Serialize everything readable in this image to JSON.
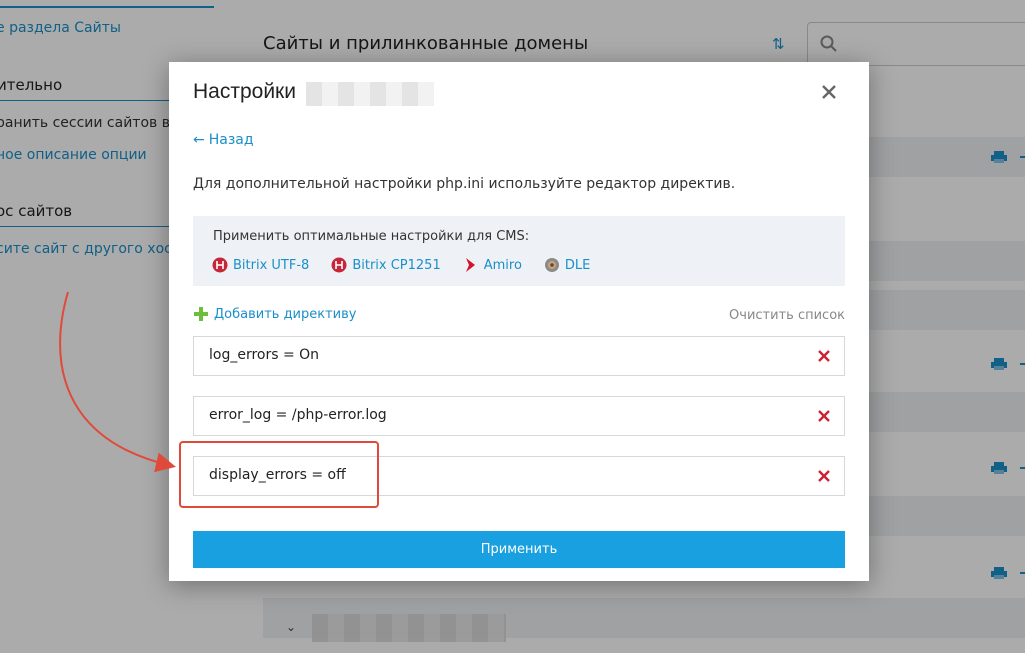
{
  "background": {
    "sidebar": {
      "link_top": "е раздела Сайты",
      "heading_1": "ительно",
      "text_1": "ранить сессии сайтов в R",
      "link_desc": "ное описание опции",
      "heading_2": "ос сайтов",
      "link_transfer": "сите сайт с другого хости"
    },
    "main_title": "Сайты и прилинкованные домены",
    "sort_icon": "sort-arrows-icon",
    "search_icon": "search-icon",
    "row_icon": "printer-icon",
    "bottom_chevron": "chevron-down-icon"
  },
  "modal": {
    "title": "Настройки",
    "close_icon": "close-icon",
    "back_label": "Назад",
    "back_arrow": "←",
    "intro_text": "Для дополнительной настройки php.ini используйте редактор директив.",
    "cms": {
      "label": "Применить оптимальные настройки для CMS:",
      "items": [
        {
          "label": "Bitrix UTF-8",
          "icon": "bitrix-icon"
        },
        {
          "label": "Bitrix CP1251",
          "icon": "bitrix-icon"
        },
        {
          "label": "Amiro",
          "icon": "amiro-icon"
        },
        {
          "label": "DLE",
          "icon": "dle-icon"
        }
      ]
    },
    "add_directive_label": "Добавить директиву",
    "add_icon": "plus-icon",
    "clear_list_label": "Очистить список",
    "directives": [
      {
        "text": "log_errors = On"
      },
      {
        "text": "error_log = /php-error.log"
      },
      {
        "text": "display_errors = off"
      }
    ],
    "delete_icon": "delete-x-icon",
    "apply_label": "Применить"
  },
  "colors": {
    "accent": "#1a8fc9",
    "apply_button": "#18a0e0",
    "delete": "#cc2233",
    "annotation": "#e04a3a",
    "add_plus": "#6cbf3a"
  }
}
